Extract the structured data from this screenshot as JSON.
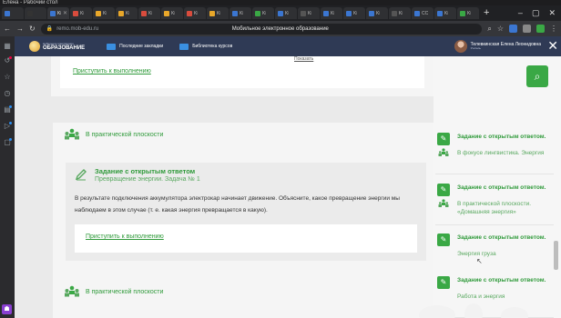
{
  "window": {
    "title": "Елена - Рабочий стол"
  },
  "browser": {
    "tabs": [
      {
        "label": "",
        "color": "#3b76d1"
      },
      {
        "label": "",
        "color": "#333"
      },
      {
        "label": "Ki",
        "color": "#3b76d1",
        "active": true
      },
      {
        "label": "Ki",
        "color": "#d94c3d"
      },
      {
        "label": "Ki",
        "color": "#e8a72a"
      },
      {
        "label": "Ki",
        "color": "#e8a72a"
      },
      {
        "label": "Ki",
        "color": "#d94c3d"
      },
      {
        "label": "Ki",
        "color": "#e8a72a"
      },
      {
        "label": "Ki",
        "color": "#d94c3d"
      },
      {
        "label": "Ki",
        "color": "#e8a72a"
      },
      {
        "label": "Ki",
        "color": "#3b76d1"
      },
      {
        "label": "Ki",
        "color": "#3aa845"
      },
      {
        "label": "Ki",
        "color": "#3b76d1"
      },
      {
        "label": "Ki",
        "color": "#555"
      },
      {
        "label": "Ki",
        "color": "#3b76d1"
      },
      {
        "label": "Ki",
        "color": "#3b76d1"
      },
      {
        "label": "Ki",
        "color": "#3b76d1"
      },
      {
        "label": "Ki",
        "color": "#555"
      },
      {
        "label": "CC",
        "color": "#3b76d1"
      },
      {
        "label": "Ki",
        "color": "#3b76d1"
      },
      {
        "label": "Ki",
        "color": "#3aa845"
      }
    ],
    "url": "remo.mob-edu.ru",
    "page_title": "Мобильное электронное образование"
  },
  "site": {
    "logo_small": "мобильное электронное",
    "logo_big": "ОБРАЗОВАНИЕ",
    "nav_recent": "Последние закладки",
    "nav_library": "Библиотека курсов",
    "user_name": "Телевкинская Елена Леонидовна",
    "user_role": "Учитель"
  },
  "main": {
    "show_label": "Показать",
    "top_link": "Приступить к выполнению",
    "section1_title": "В практической плоскости",
    "task_title": "Задание с открытым ответом",
    "task_sub": "Превращение энергии. Задача № 1",
    "task_text": "В результате подключения аккумулятора электрокар начинает движение. Объясните, какое превращение энергии мы наблюдаем в этом случае (т. е. какая энергия превращается в какую).",
    "task_link": "Приступить к выполнению",
    "section2_title": "В практической плоскости"
  },
  "right": {
    "items": [
      {
        "title": "Задание с открытым ответом.",
        "sub": "В фокусе лингвистика. Энергия"
      },
      {
        "title": "Задание с открытым ответом.",
        "sub": "В практической плоскости. «Домашняя энергия»"
      },
      {
        "title": "Задание с открытым ответом.",
        "sub": "Энергия груза"
      },
      {
        "title": "Задание с открытым ответом.",
        "sub": "Работа и энергия"
      }
    ]
  },
  "colors": {
    "accent_green": "#3aa845",
    "header_bg": "#2f3a55"
  }
}
